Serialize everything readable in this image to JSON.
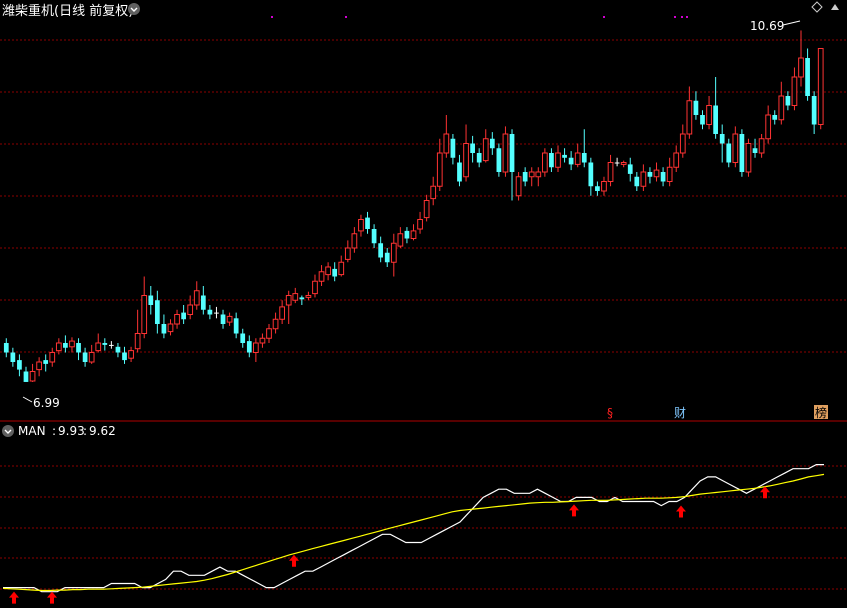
{
  "header": {
    "title": "潍柴重机(日线 前复权)",
    "indicator_label": "MAN",
    "indicator_value_1": "9.93",
    "indicator_value_2": "9.62",
    "separator": ":"
  },
  "markers": {
    "high_label": "10.69",
    "low_label": "6.99",
    "event_s": "§",
    "event_cai": "财",
    "event_bang": "榜"
  },
  "colors": {
    "up": "#ff3333",
    "down": "#54ffff",
    "grid": "#8b0000",
    "white_line": "#ffffff",
    "yellow_line": "#ffff00",
    "arrow": "#ff0000",
    "flat": "#ffffff"
  },
  "chart_data": [
    {
      "type": "candlestick",
      "title": "潍柴重机(日线 前复权)",
      "ylim": [
        6.8,
        10.8
      ],
      "high_annotation": 10.69,
      "low_annotation": 6.99,
      "candles": [
        [
          7.4,
          7.3,
          7.45,
          7.25
        ],
        [
          7.3,
          7.2,
          7.35,
          7.15
        ],
        [
          7.22,
          7.12,
          7.28,
          7.05
        ],
        [
          7.1,
          6.99,
          7.15,
          6.99
        ],
        [
          7.0,
          7.1,
          7.18,
          6.99
        ],
        [
          7.12,
          7.2,
          7.25,
          7.05
        ],
        [
          7.22,
          7.18,
          7.28,
          7.1
        ],
        [
          7.2,
          7.3,
          7.35,
          7.15
        ],
        [
          7.32,
          7.4,
          7.45,
          7.28
        ],
        [
          7.4,
          7.35,
          7.48,
          7.3
        ],
        [
          7.36,
          7.42,
          7.46,
          7.3
        ],
        [
          7.4,
          7.3,
          7.45,
          7.22
        ],
        [
          7.3,
          7.2,
          7.35,
          7.15
        ],
        [
          7.2,
          7.3,
          7.38,
          7.18
        ],
        [
          7.32,
          7.4,
          7.5,
          7.3
        ],
        [
          7.4,
          7.38,
          7.45,
          7.32
        ],
        [
          7.38,
          7.38,
          7.42,
          7.34
        ],
        [
          7.36,
          7.3,
          7.4,
          7.25
        ],
        [
          7.3,
          7.22,
          7.36,
          7.18
        ],
        [
          7.24,
          7.32,
          7.36,
          7.2
        ],
        [
          7.34,
          7.5,
          7.75,
          7.3
        ],
        [
          7.5,
          7.9,
          8.1,
          7.45
        ],
        [
          7.9,
          7.8,
          8.0,
          7.7
        ],
        [
          7.85,
          7.6,
          7.95,
          7.5
        ],
        [
          7.6,
          7.5,
          7.7,
          7.45
        ],
        [
          7.52,
          7.6,
          7.65,
          7.48
        ],
        [
          7.6,
          7.7,
          7.75,
          7.55
        ],
        [
          7.72,
          7.65,
          7.8,
          7.6
        ],
        [
          7.7,
          7.8,
          7.9,
          7.65
        ],
        [
          7.8,
          7.95,
          8.05,
          7.75
        ],
        [
          7.9,
          7.75,
          8.0,
          7.7
        ],
        [
          7.75,
          7.7,
          7.8,
          7.65
        ],
        [
          7.72,
          7.72,
          7.78,
          7.66
        ],
        [
          7.7,
          7.6,
          7.75,
          7.55
        ],
        [
          7.62,
          7.68,
          7.72,
          7.58
        ],
        [
          7.66,
          7.5,
          7.72,
          7.45
        ],
        [
          7.5,
          7.4,
          7.55,
          7.35
        ],
        [
          7.42,
          7.3,
          7.48,
          7.25
        ],
        [
          7.3,
          7.4,
          7.45,
          7.2
        ],
        [
          7.4,
          7.45,
          7.5,
          7.35
        ],
        [
          7.45,
          7.55,
          7.6,
          7.4
        ],
        [
          7.55,
          7.65,
          7.72,
          7.5
        ],
        [
          7.65,
          7.78,
          7.85,
          7.6
        ],
        [
          7.8,
          7.9,
          7.95,
          7.6
        ],
        [
          7.85,
          7.92,
          7.98,
          7.82
        ],
        [
          7.88,
          7.86,
          7.9,
          7.8
        ],
        [
          7.88,
          7.9,
          7.94,
          7.85
        ],
        [
          7.92,
          8.05,
          8.12,
          7.88
        ],
        [
          8.05,
          8.15,
          8.22,
          8.0
        ],
        [
          8.12,
          8.2,
          8.25,
          8.06
        ],
        [
          8.18,
          8.1,
          8.25,
          8.05
        ],
        [
          8.12,
          8.25,
          8.32,
          8.1
        ],
        [
          8.28,
          8.4,
          8.48,
          8.25
        ],
        [
          8.4,
          8.55,
          8.62,
          8.35
        ],
        [
          8.58,
          8.7,
          8.75,
          8.52
        ],
        [
          8.72,
          8.6,
          8.78,
          8.55
        ],
        [
          8.6,
          8.45,
          8.65,
          8.4
        ],
        [
          8.45,
          8.3,
          8.52,
          8.25
        ],
        [
          8.35,
          8.25,
          8.4,
          8.2
        ],
        [
          8.25,
          8.45,
          8.55,
          8.1
        ],
        [
          8.42,
          8.55,
          8.62,
          8.4
        ],
        [
          8.58,
          8.5,
          8.62,
          8.45
        ],
        [
          8.5,
          8.58,
          8.65,
          8.48
        ],
        [
          8.6,
          8.7,
          8.78,
          8.55
        ],
        [
          8.72,
          8.9,
          8.96,
          8.68
        ],
        [
          8.92,
          9.05,
          9.15,
          8.85
        ],
        [
          9.05,
          9.4,
          9.55,
          9.0
        ],
        [
          9.4,
          9.6,
          9.8,
          9.35
        ],
        [
          9.55,
          9.35,
          9.6,
          9.28
        ],
        [
          9.3,
          9.1,
          9.38,
          9.05
        ],
        [
          9.15,
          9.5,
          9.7,
          9.1
        ],
        [
          9.5,
          9.4,
          9.58,
          9.3
        ],
        [
          9.4,
          9.3,
          9.45,
          9.25
        ],
        [
          9.32,
          9.55,
          9.65,
          9.3
        ],
        [
          9.55,
          9.45,
          9.62,
          9.38
        ],
        [
          9.45,
          9.2,
          9.5,
          9.15
        ],
        [
          9.2,
          9.6,
          9.68,
          9.15
        ],
        [
          9.6,
          9.2,
          9.65,
          8.9
        ],
        [
          8.95,
          9.15,
          9.2,
          8.9
        ],
        [
          9.2,
          9.1,
          9.25,
          9.05
        ],
        [
          9.15,
          9.2,
          9.25,
          9.05
        ],
        [
          9.15,
          9.2,
          9.25,
          9.05
        ],
        [
          9.2,
          9.4,
          9.45,
          9.15
        ],
        [
          9.4,
          9.25,
          9.45,
          9.2
        ],
        [
          9.25,
          9.4,
          9.48,
          9.2
        ],
        [
          9.38,
          9.35,
          9.45,
          9.3
        ],
        [
          9.35,
          9.28,
          9.42,
          9.22
        ],
        [
          9.28,
          9.4,
          9.5,
          9.25
        ],
        [
          9.4,
          9.3,
          9.65,
          9.25
        ],
        [
          9.3,
          9.05,
          9.35,
          8.95
        ],
        [
          9.05,
          9.0,
          9.1,
          8.95
        ],
        [
          9.0,
          9.1,
          9.15,
          8.95
        ],
        [
          9.1,
          9.3,
          9.38,
          9.05
        ],
        [
          9.3,
          9.3,
          9.35,
          9.26
        ],
        [
          9.28,
          9.3,
          9.32,
          9.25
        ],
        [
          9.28,
          9.18,
          9.35,
          9.1
        ],
        [
          9.15,
          9.05,
          9.2,
          9.0
        ],
        [
          9.05,
          9.2,
          9.28,
          9.0
        ],
        [
          9.2,
          9.15,
          9.25,
          9.08
        ],
        [
          9.15,
          9.22,
          9.3,
          9.1
        ],
        [
          9.2,
          9.1,
          9.25,
          9.05
        ],
        [
          9.1,
          9.25,
          9.35,
          9.05
        ],
        [
          9.25,
          9.4,
          9.48,
          9.2
        ],
        [
          9.4,
          9.6,
          9.7,
          9.35
        ],
        [
          9.6,
          9.95,
          10.1,
          9.55
        ],
        [
          9.95,
          9.8,
          10.05,
          9.75
        ],
        [
          9.8,
          9.7,
          9.85,
          9.65
        ],
        [
          9.7,
          9.9,
          10.0,
          9.65
        ],
        [
          9.9,
          9.6,
          10.2,
          9.55
        ],
        [
          9.6,
          9.5,
          9.7,
          9.3
        ],
        [
          9.5,
          9.3,
          9.55,
          9.25
        ],
        [
          9.3,
          9.6,
          9.68,
          9.25
        ],
        [
          9.6,
          9.2,
          9.65,
          9.15
        ],
        [
          9.2,
          9.5,
          9.55,
          9.15
        ],
        [
          9.45,
          9.4,
          9.55,
          9.35
        ],
        [
          9.4,
          9.55,
          9.6,
          9.35
        ],
        [
          9.55,
          9.8,
          9.9,
          9.5
        ],
        [
          9.8,
          9.75,
          9.85,
          9.7
        ],
        [
          9.75,
          10.0,
          10.15,
          9.7
        ],
        [
          10.0,
          9.9,
          10.05,
          9.85
        ],
        [
          9.9,
          10.2,
          10.3,
          9.85
        ],
        [
          10.2,
          10.4,
          10.69,
          10.1
        ],
        [
          10.4,
          10.0,
          10.5,
          9.95
        ],
        [
          10.0,
          9.7,
          10.05,
          9.6
        ],
        [
          9.7,
          10.5,
          10.5,
          9.65
        ]
      ]
    },
    {
      "type": "line",
      "ylim": [
        6.8,
        10.8
      ],
      "series": [
        {
          "name": "MAN",
          "color": "white",
          "values": [
            7.2,
            7.2,
            7.2,
            7.2,
            7.2,
            7.1,
            7.1,
            7.1,
            7.2,
            7.2,
            7.2,
            7.2,
            7.2,
            7.2,
            7.3,
            7.3,
            7.3,
            7.3,
            7.2,
            7.2,
            7.3,
            7.4,
            7.6,
            7.6,
            7.5,
            7.5,
            7.5,
            7.6,
            7.7,
            7.6,
            7.6,
            7.5,
            7.4,
            7.3,
            7.2,
            7.2,
            7.3,
            7.4,
            7.5,
            7.6,
            7.6,
            7.7,
            7.8,
            7.9,
            8.0,
            8.1,
            8.2,
            8.3,
            8.4,
            8.5,
            8.5,
            8.4,
            8.3,
            8.3,
            8.3,
            8.4,
            8.5,
            8.6,
            8.7,
            8.8,
            9.0,
            9.2,
            9.4,
            9.5,
            9.6,
            9.6,
            9.5,
            9.5,
            9.5,
            9.6,
            9.5,
            9.4,
            9.3,
            9.3,
            9.4,
            9.4,
            9.4,
            9.3,
            9.3,
            9.4,
            9.3,
            9.3,
            9.3,
            9.3,
            9.3,
            9.2,
            9.3,
            9.3,
            9.4,
            9.6,
            9.8,
            9.9,
            9.9,
            9.8,
            9.7,
            9.6,
            9.5,
            9.6,
            9.7,
            9.8,
            9.9,
            10.0,
            10.1,
            10.1,
            10.1,
            10.2,
            10.2
          ]
        },
        {
          "name": "MAN",
          "color": "yellow",
          "values": [
            7.18,
            7.17,
            7.16,
            7.15,
            7.14,
            7.13,
            7.13,
            7.14,
            7.14,
            7.15,
            7.15,
            7.16,
            7.16,
            7.16,
            7.17,
            7.18,
            7.19,
            7.2,
            7.21,
            7.23,
            7.25,
            7.27,
            7.29,
            7.31,
            7.33,
            7.35,
            7.38,
            7.42,
            7.47,
            7.52,
            7.58,
            7.64,
            7.7,
            7.76,
            7.82,
            7.88,
            7.94,
            8.0,
            8.05,
            8.1,
            8.15,
            8.2,
            8.25,
            8.3,
            8.35,
            8.4,
            8.45,
            8.5,
            8.55,
            8.6,
            8.65,
            8.7,
            8.75,
            8.8,
            8.85,
            8.9,
            8.95,
            9.0,
            9.05,
            9.08,
            9.1,
            9.12,
            9.14,
            9.16,
            9.18,
            9.2,
            9.22,
            9.24,
            9.26,
            9.27,
            9.28,
            9.28,
            9.29,
            9.3,
            9.31,
            9.32,
            9.33,
            9.33,
            9.33,
            9.34,
            9.35,
            9.36,
            9.37,
            9.38,
            9.38,
            9.38,
            9.39,
            9.4,
            9.42,
            9.45,
            9.48,
            9.5,
            9.52,
            9.54,
            9.56,
            9.58,
            9.6,
            9.62,
            9.65,
            9.68,
            9.72,
            9.76,
            9.8,
            9.85,
            9.9,
            9.93,
            9.96
          ]
        }
      ],
      "signal_arrows": [
        1,
        10,
        68,
        138,
        162,
        205,
        245
      ]
    }
  ]
}
